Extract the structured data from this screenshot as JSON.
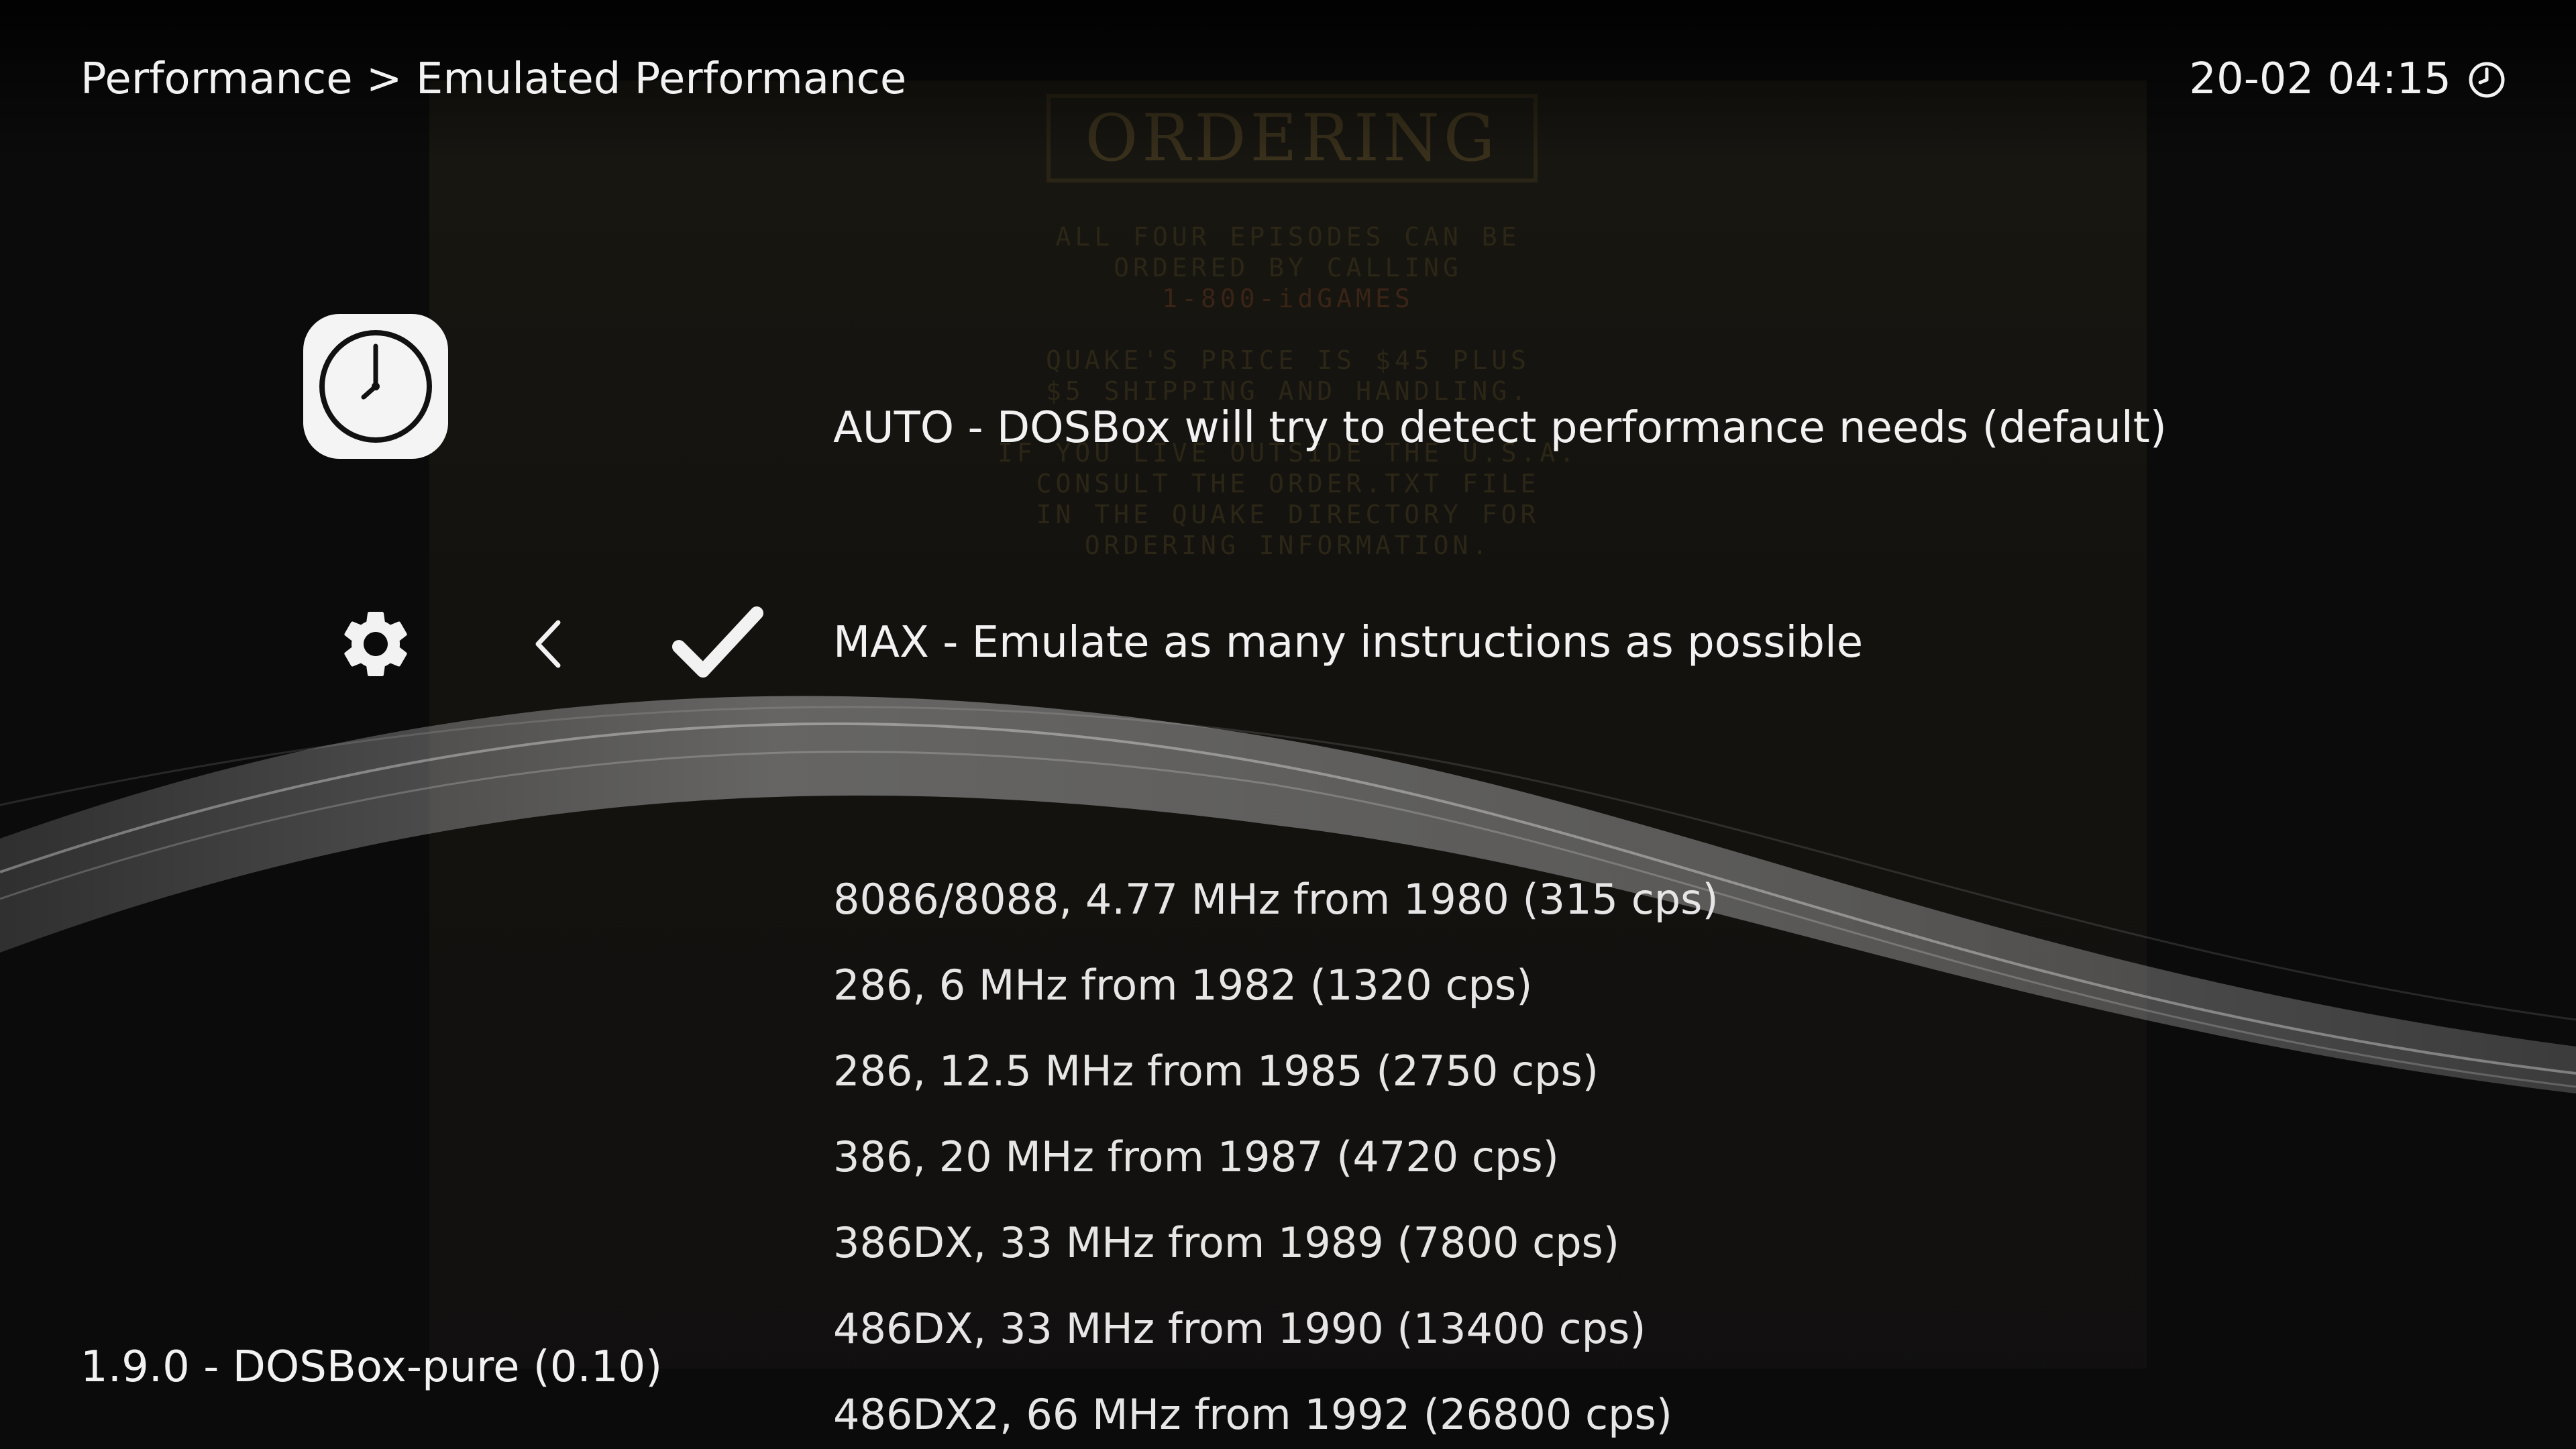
{
  "header": {
    "breadcrumb": "Performance > Emulated Performance",
    "datetime": "20-02 04:15",
    "clock_icon": "clock-icon"
  },
  "background": {
    "title": "ORDERING",
    "lines": [
      "ALL FOUR EPISODES CAN BE",
      "ORDERED BY CALLING",
      "1-800-idGAMES",
      "",
      "QUAKE'S PRICE IS $45 PLUS",
      "$5 SHIPPING AND HANDLING.",
      "",
      "IF YOU LIVE OUTSIDE THE U.S.A.",
      "CONSULT THE ORDER.TXT FILE",
      "IN THE QUAKE DIRECTORY FOR",
      "ORDERING INFORMATION."
    ]
  },
  "sidebar": {
    "app_icon": "clock-app-icon",
    "setting_icon": "gear-icon",
    "back_icon": "chevron-left-icon",
    "selected_icon": "checkmark-icon"
  },
  "menu": {
    "auto_label": "AUTO - DOSBox will try to detect performance needs (default)",
    "max_label": "MAX - Emulate as many instructions as possible"
  },
  "options": [
    "8086/8088, 4.77 MHz from 1980 (315 cps)",
    "286, 6 MHz from 1982 (1320 cps)",
    "286, 12.5 MHz from 1985 (2750 cps)",
    "386, 20 MHz from 1987 (4720 cps)",
    "386DX, 33 MHz from 1989 (7800 cps)",
    "486DX, 33 MHz from 1990 (13400 cps)",
    "486DX2, 66 MHz from 1992 (26800 cps)"
  ],
  "footer": {
    "version": "1.9.0 - DOSBox-pure (0.10)"
  },
  "colors": {
    "background": "#0b0b0b",
    "text": "#f2f2f2",
    "icon_bg": "#f4f4f4"
  }
}
